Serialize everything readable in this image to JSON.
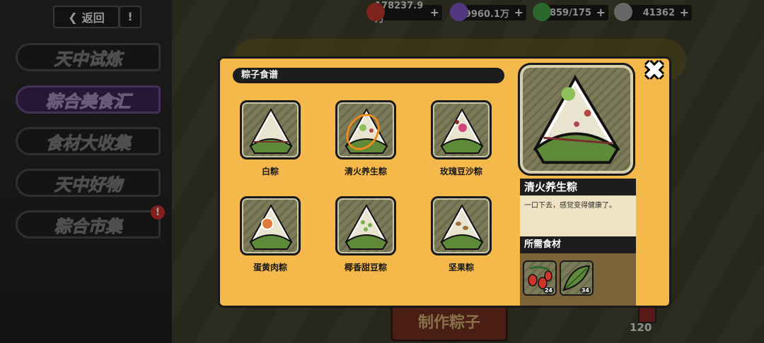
{
  "topbar": {
    "back_label": "返回",
    "info_label": "!",
    "resources": [
      {
        "name": "meat",
        "value": "178237.9万",
        "color": "#c0392b"
      },
      {
        "name": "crystal",
        "value": "9960.1万",
        "color": "#7e57c2"
      },
      {
        "name": "energy",
        "value": "859/175",
        "color": "#43a047"
      },
      {
        "name": "ticket",
        "value": "41362",
        "color": "#9e9e9e"
      }
    ]
  },
  "menu": {
    "items": [
      {
        "label": "天中试炼"
      },
      {
        "label": "粽合美食汇"
      },
      {
        "label": "食材大收集"
      },
      {
        "label": "天中好物"
      },
      {
        "label": "粽合市集"
      }
    ],
    "alert": "!"
  },
  "background": {
    "make_button": "制作粽子",
    "counter": "120"
  },
  "modal": {
    "title": "粽子食谱",
    "close_label": "✖",
    "recipes": [
      {
        "name": "白粽"
      },
      {
        "name": "清火养生粽"
      },
      {
        "name": "玫瑰豆沙粽"
      },
      {
        "name": "蛋黄肉粽"
      },
      {
        "name": "椰香甜豆粽"
      },
      {
        "name": "坚果粽"
      }
    ],
    "detail": {
      "name": "清火养生粽",
      "description": "一口下去，感觉变得健康了。",
      "ingredients_title": "所需食材",
      "ingredients": [
        {
          "icon": "goji-berry-icon",
          "count": "24"
        },
        {
          "icon": "leaf-icon",
          "count": "34"
        }
      ]
    }
  }
}
